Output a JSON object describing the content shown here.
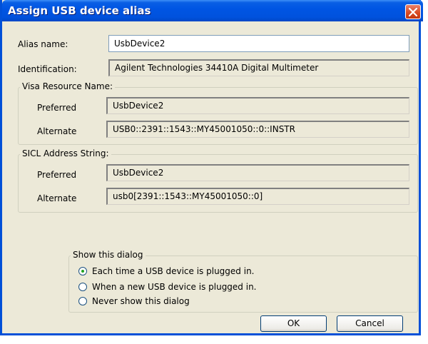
{
  "window": {
    "title": "Assign USB device alias"
  },
  "alias": {
    "label": "Alias name:",
    "value": "UsbDevice2"
  },
  "identification": {
    "label": "Identification:",
    "value": "Agilent Technologies 34410A Digital Multimeter"
  },
  "visa": {
    "legend": "Visa Resource Name:",
    "preferred_label": "Preferred",
    "preferred_value": "UsbDevice2",
    "alternate_label": "Alternate",
    "alternate_value": "USB0::2391::1543::MY45001050::0::INSTR"
  },
  "sicl": {
    "legend": "SICL Address String:",
    "preferred_label": "Preferred",
    "preferred_value": "UsbDevice2",
    "alternate_label": "Alternate",
    "alternate_value": "usb0[2391::1543::MY45001050::0]"
  },
  "show_dialog": {
    "legend": "Show this dialog",
    "options": [
      {
        "label": "Each time a USB device is plugged in.",
        "selected": true
      },
      {
        "label": "When a new USB device is plugged in.",
        "selected": false
      },
      {
        "label": "Never show this dialog",
        "selected": false
      }
    ]
  },
  "buttons": {
    "ok": "OK",
    "cancel": "Cancel"
  },
  "icons": {
    "close": "close-icon",
    "radio_dot": "radio-selected-dot"
  },
  "colors": {
    "titlebar": "#0055e3",
    "close": "#d84920",
    "face": "#ece9d8",
    "radio_dot": "#21a121"
  }
}
